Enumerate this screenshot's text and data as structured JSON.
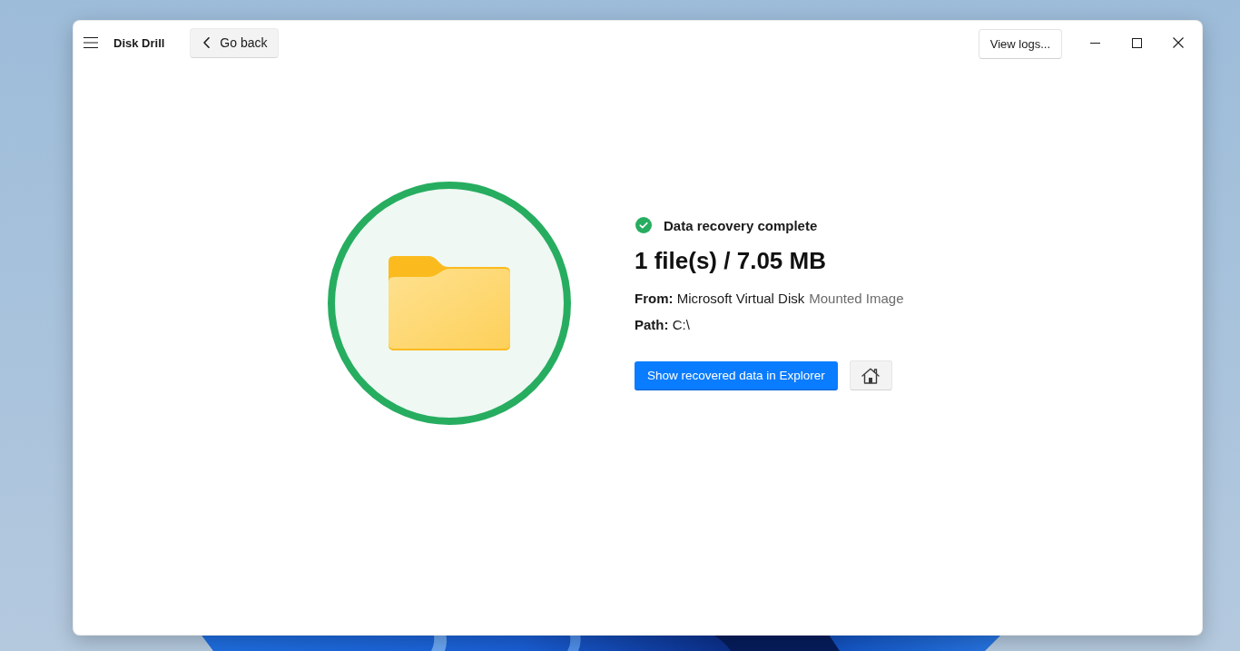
{
  "window": {
    "title": "Disk Drill",
    "go_back": "Go back",
    "view_logs": "View logs..."
  },
  "result": {
    "status": "Data recovery complete",
    "summary": "1 file(s) / 7.05 MB",
    "source": "**From:** Microsoft Virtual Disk",
    "source_type": "Mounted Image",
    "path": "**Path:** C:\\",
    "primary_button": "Show recovered data in Explorer"
  }
}
